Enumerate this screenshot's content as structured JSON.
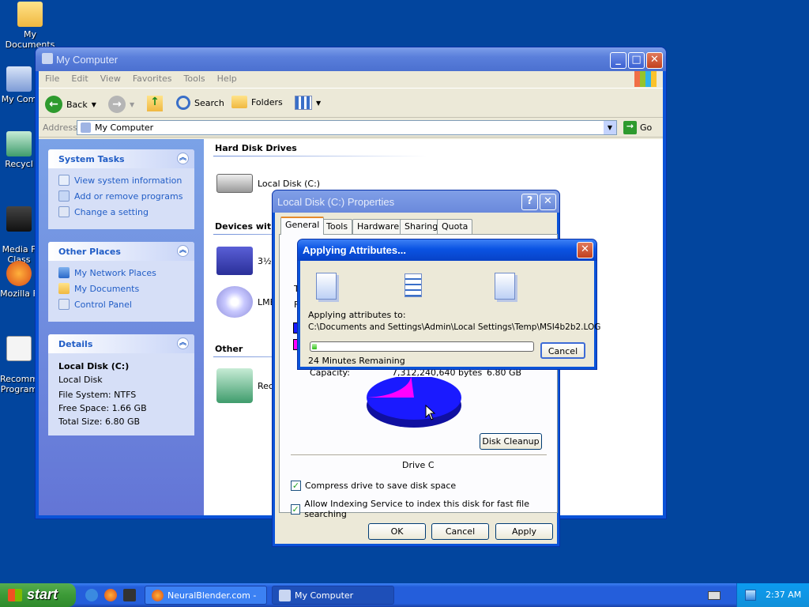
{
  "desktop": {
    "icons": [
      {
        "label": "My Documents"
      },
      {
        "label": "My Com"
      },
      {
        "label": "Recycl"
      },
      {
        "label": "Media F\nClass"
      },
      {
        "label": "Mozilla F"
      },
      {
        "label": "Recomm\nProgram"
      }
    ]
  },
  "explorer": {
    "title": "My Computer",
    "menu": [
      "File",
      "Edit",
      "View",
      "Favorites",
      "Tools",
      "Help"
    ],
    "toolbar": {
      "back": "Back",
      "search": "Search",
      "folders": "Folders"
    },
    "address": {
      "label": "Address",
      "value": "My Computer",
      "go": "Go"
    },
    "system_tasks": {
      "title": "System Tasks",
      "items": [
        "View system information",
        "Add or remove programs",
        "Change a setting"
      ]
    },
    "other_places": {
      "title": "Other Places",
      "items": [
        "My Network Places",
        "My Documents",
        "Control Panel"
      ]
    },
    "details": {
      "title": "Details",
      "name": "Local Disk (C:)",
      "type": "Local Disk",
      "file_system": "File System: NTFS",
      "free_space": "Free Space: 1.66 GB",
      "total_size": "Total Size: 6.80 GB"
    },
    "sections": {
      "hard_disk": "Hard Disk Drives",
      "devices": "Devices with",
      "other": "Other"
    },
    "items": {
      "local_disk": "Local Disk (C:)",
      "floppy": "3½",
      "lme": "LME",
      "recycle": "Rec"
    }
  },
  "properties": {
    "title": "Local Disk (C:) Properties",
    "tabs": [
      "General",
      "Tools",
      "Hardware",
      "Sharing",
      "Quota"
    ],
    "partial_labels": {
      "ty": "Ty",
      "fi": "Fi"
    },
    "capacity": {
      "label": "Capacity:",
      "bytes": "7,312,240,640 bytes",
      "gb": "6.80 GB"
    },
    "drive_label": "Drive C",
    "disk_cleanup": "Disk Cleanup",
    "compress": "Compress drive to save disk space",
    "indexing": "Allow Indexing Service to index this disk for fast file searching",
    "buttons": {
      "ok": "OK",
      "cancel": "Cancel",
      "apply": "Apply"
    },
    "colors": {
      "used": "#1a1aff",
      "free": "#ff00ff"
    },
    "used_fraction": 0.76
  },
  "apply_dialog": {
    "title": "Applying Attributes...",
    "label": "Applying attributes to:",
    "path": "C:\\Documents and Settings\\Admin\\Local Settings\\Temp\\MSI4b2b2.LOG",
    "remaining": "24 Minutes Remaining",
    "cancel": "Cancel",
    "progress": 0.02
  },
  "taskbar": {
    "start": "start",
    "tasks": [
      {
        "label": "NeuralBlender.com - ..."
      },
      {
        "label": "My Computer"
      }
    ],
    "clock": "2:37 AM"
  }
}
